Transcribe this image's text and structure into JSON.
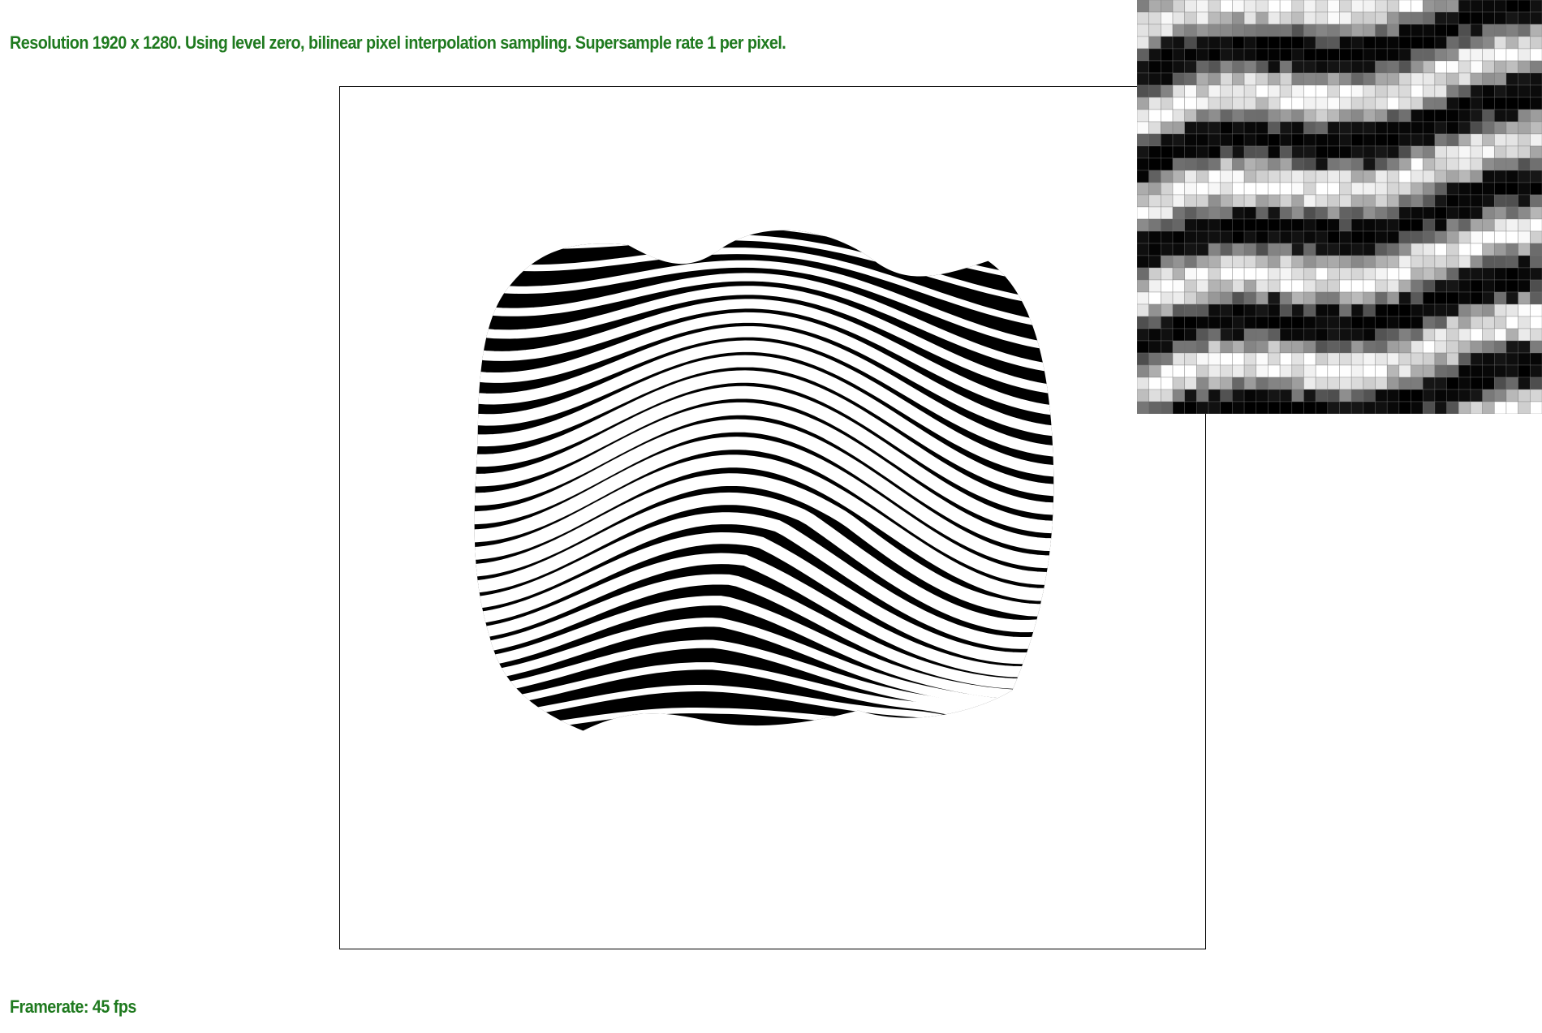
{
  "status": {
    "resolution_text": "Resolution 1920 x 1280. Using level zero, bilinear pixel interpolation sampling. Supersample rate 1 per pixel.",
    "framerate_text": "Framerate: 45 fps"
  },
  "colors": {
    "status_text": "#1f7a1f",
    "stripe_dark": "#000000",
    "stripe_light": "#ffffff",
    "frame_border": "#000000"
  },
  "zoom_panel": {
    "grid_rows": 34,
    "grid_cols": 34
  }
}
